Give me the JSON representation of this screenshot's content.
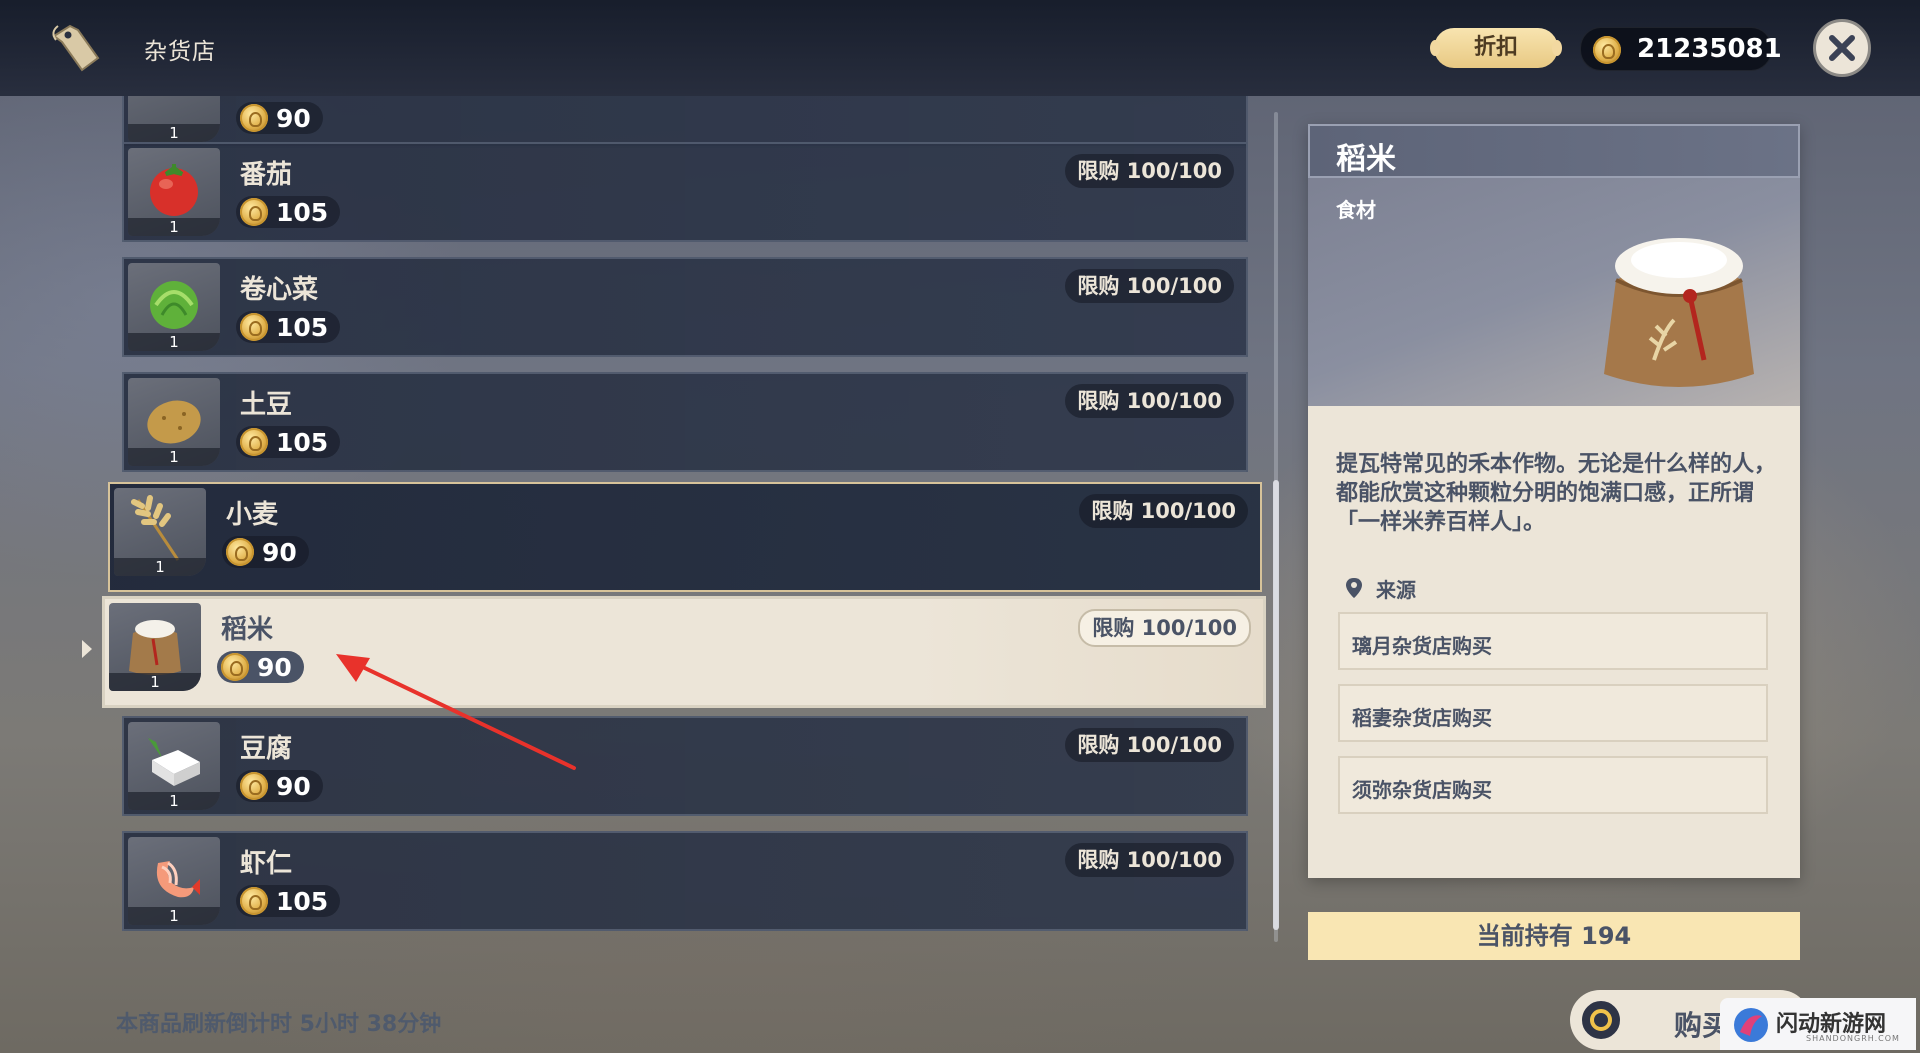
{
  "header": {
    "shop_title": "杂货店",
    "discount_label": "折扣",
    "mora": "21235081"
  },
  "items": [
    {
      "name": "",
      "price": "90",
      "qty": "1",
      "limit": ""
    },
    {
      "name": "番茄",
      "price": "105",
      "qty": "1",
      "limit": "限购 100/100"
    },
    {
      "name": "卷心菜",
      "price": "105",
      "qty": "1",
      "limit": "限购 100/100"
    },
    {
      "name": "土豆",
      "price": "105",
      "qty": "1",
      "limit": "限购 100/100"
    },
    {
      "name": "小麦",
      "price": "90",
      "qty": "1",
      "limit": "限购 100/100"
    },
    {
      "name": "稻米",
      "price": "90",
      "qty": "1",
      "limit": "限购 100/100"
    },
    {
      "name": "豆腐",
      "price": "90",
      "qty": "1",
      "limit": "限购 100/100"
    },
    {
      "name": "虾仁",
      "price": "105",
      "qty": "1",
      "limit": "限购 100/100"
    }
  ],
  "refresh_text": "本商品刷新倒计时 5小时 38分钟",
  "detail": {
    "title": "稻米",
    "category": "食材",
    "description": "提瓦特常见的禾本作物。无论是什么样的人，都能欣赏这种颗粒分明的饱满口感，正所谓「一样米养百样人」。",
    "source_label": "来源",
    "sources": [
      "璃月杂货店购买",
      "稻妻杂货店购买",
      "须弥杂货店购买"
    ],
    "holding": "当前持有 194"
  },
  "buy_label": "购买",
  "watermark": {
    "text": "闪动新游网",
    "sub": "SHANDONGRH.COM"
  },
  "colors": {
    "accent": "#ece5d8",
    "panel_dark": "#2e3648",
    "gold": "#e0b04a",
    "annotation": "#e8322b"
  }
}
